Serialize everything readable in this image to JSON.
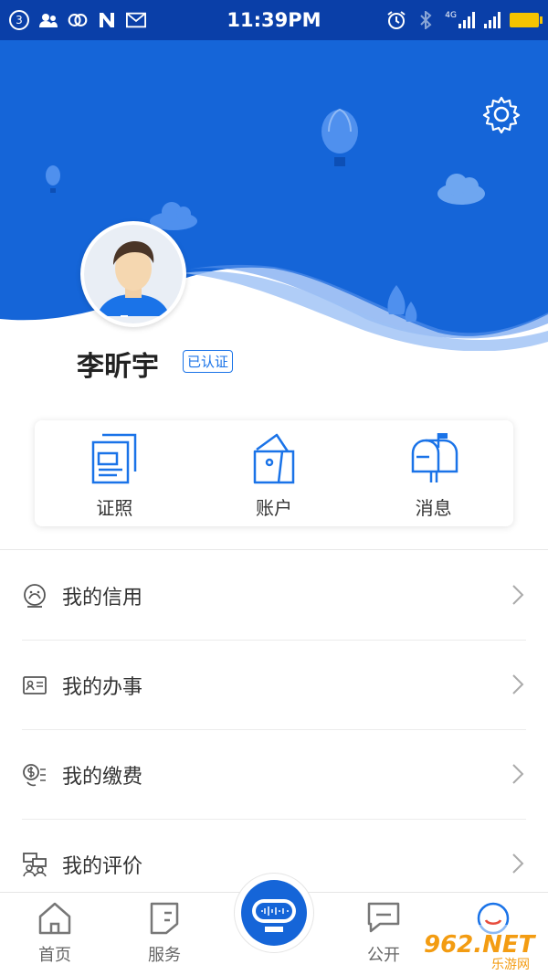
{
  "status_bar": {
    "notification_count": "3",
    "time": "11:39PM",
    "network_label": "4G",
    "left_icons": [
      "contacts-icon",
      "link-icon",
      "n-app-icon",
      "mail-icon"
    ],
    "right_icons": [
      "alarm-icon",
      "bluetooth-icon",
      "signal-icon",
      "signal-icon",
      "battery-icon"
    ]
  },
  "header": {
    "settings_icon": "gear-icon",
    "background_color": "#1565d8"
  },
  "profile": {
    "name": "李昕宇",
    "verified_label": "已认证"
  },
  "quick_actions": [
    {
      "label": "证照",
      "icon": "document-icon"
    },
    {
      "label": "账户",
      "icon": "wallet-icon"
    },
    {
      "label": "消息",
      "icon": "mailbox-icon"
    }
  ],
  "menu": [
    {
      "label": "我的信用",
      "icon": "credit-icon"
    },
    {
      "label": "我的办事",
      "icon": "id-card-icon"
    },
    {
      "label": "我的缴费",
      "icon": "payment-icon"
    },
    {
      "label": "我的评价",
      "icon": "review-icon"
    }
  ],
  "bottom_nav": [
    {
      "label": "首页",
      "icon": "home-icon"
    },
    {
      "label": "服务",
      "icon": "service-icon"
    },
    {
      "label": "公开",
      "icon": "chat-icon"
    }
  ],
  "watermark": {
    "text_top": "962.NET",
    "text_bottom": "乐游网"
  },
  "colors": {
    "accent": "#1565d8",
    "status_bar": "#0a3fa8"
  }
}
